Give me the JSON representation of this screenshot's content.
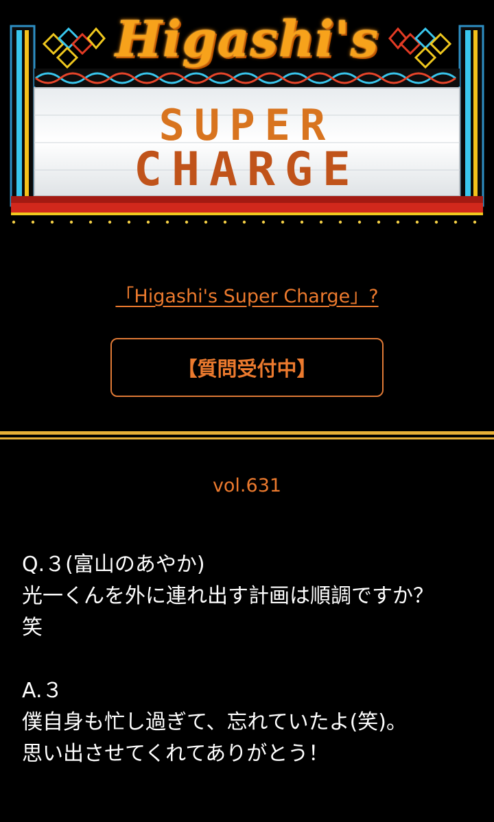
{
  "banner": {
    "logo_text": "Higashi's",
    "sign_line_1": "SUPER",
    "sign_line_2": "CHARGE",
    "colors": {
      "logo": "#f7a21b",
      "sign_text": "#c9621b",
      "neon_blue": "#37c8f0",
      "frame_red": "#d2281c"
    }
  },
  "about_link": "「Higashi's Super Charge」?",
  "question_button": "【質問受付中】",
  "volume": "vol.631",
  "question": {
    "header": "Q.３(富山のあやか)",
    "lines": [
      "光一くんを外に連れ出す計画は順調ですか？",
      "笑"
    ]
  },
  "answer": {
    "header": "A.３",
    "lines": [
      "僕自身も忙し過ぎて、忘れていたよ(笑)。",
      "思い出させてくれてありがとう！"
    ]
  }
}
